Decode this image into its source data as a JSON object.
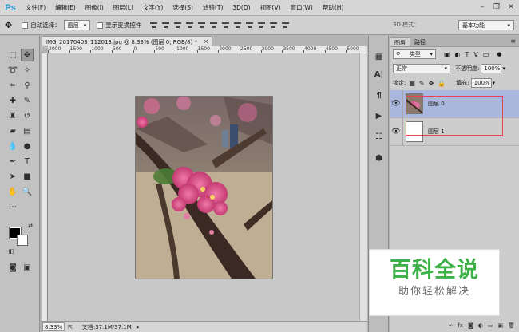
{
  "app": {
    "logo": "Ps",
    "menu": [
      "文件(F)",
      "编辑(E)",
      "图像(I)",
      "图层(L)",
      "文字(Y)",
      "选择(S)",
      "滤镜(T)",
      "3D(D)",
      "视图(V)",
      "窗口(W)",
      "帮助(H)"
    ],
    "window_controls": {
      "minimize": "–",
      "restore": "❐",
      "close": "✕"
    }
  },
  "options": {
    "auto_select_label": "自动选择：",
    "auto_select_value": "图层",
    "show_transform_label": "显示变换控件",
    "mode_3d_label": "3D 模式：",
    "workspace": "基本功能"
  },
  "document": {
    "tab_title": "IMG_20170403_112013.jpg @ 8.33% (图层 0, RGB/8) *",
    "tab_close": "×",
    "ruler_ticks": [
      "2000",
      "1500",
      "1000",
      "500",
      "0",
      "500",
      "1000",
      "1500",
      "2000",
      "2500",
      "3000",
      "3500",
      "4000",
      "4500",
      "5000"
    ],
    "zoom": "8.33%",
    "status": "文档:37.1M/37.1M"
  },
  "layers_panel": {
    "tabs": [
      "图层",
      "路径"
    ],
    "filter_label": "类型",
    "blend_mode": "正常",
    "opacity_label": "不透明度:",
    "opacity_value": "100%",
    "lock_label": "锁定:",
    "fill_label": "填充:",
    "fill_value": "100%",
    "layers": [
      {
        "name": "图层 0",
        "selected": true
      },
      {
        "name": "图层 1",
        "selected": false
      }
    ],
    "footer_icons": [
      "∞",
      "fx",
      "◙",
      "◐",
      "▭",
      "▣",
      "🗑"
    ]
  },
  "watermark": {
    "main": "百科全说",
    "sub": "助你轻松解决"
  },
  "colors": {
    "accent": "#2d9ad8",
    "selected_layer": "#aab8dd",
    "highlight_box": "#e8454f",
    "watermark_green": "#3db047"
  }
}
